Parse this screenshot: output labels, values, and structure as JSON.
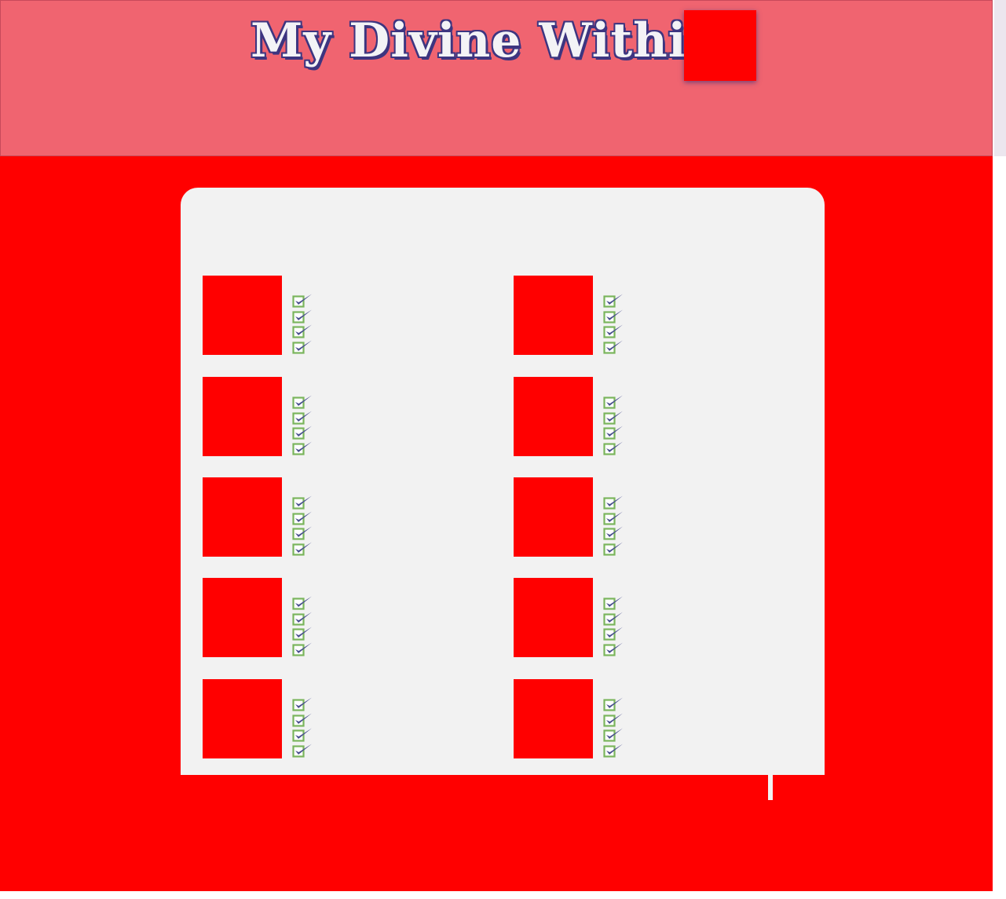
{
  "header": {
    "title": "My Divine Within",
    "image_name": "header-image"
  },
  "colors": {
    "header_bg": "#f06470",
    "main_bg": "#ff0000",
    "card_bg": "#f2f2f2",
    "title_fill": "#f3f3f6",
    "title_outline": "#3d3580",
    "check_box": "#7ab55c",
    "check_mark": "#4a4f8f"
  },
  "items": [
    {
      "name": "item-1",
      "checks": 4,
      "icon": "checkbox-checked-icon"
    },
    {
      "name": "item-2",
      "checks": 4,
      "icon": "checkbox-checked-icon"
    },
    {
      "name": "item-3",
      "checks": 4,
      "icon": "checkbox-checked-icon"
    },
    {
      "name": "item-4",
      "checks": 4,
      "icon": "checkbox-checked-icon"
    },
    {
      "name": "item-5",
      "checks": 4,
      "icon": "checkbox-checked-icon"
    },
    {
      "name": "item-6",
      "checks": 4,
      "icon": "checkbox-checked-icon"
    },
    {
      "name": "item-7",
      "checks": 4,
      "icon": "checkbox-checked-icon"
    },
    {
      "name": "item-8",
      "checks": 4,
      "icon": "checkbox-checked-icon"
    },
    {
      "name": "item-9",
      "checks": 4,
      "icon": "checkbox-checked-icon"
    },
    {
      "name": "item-10",
      "checks": 4,
      "icon": "checkbox-checked-icon"
    }
  ]
}
